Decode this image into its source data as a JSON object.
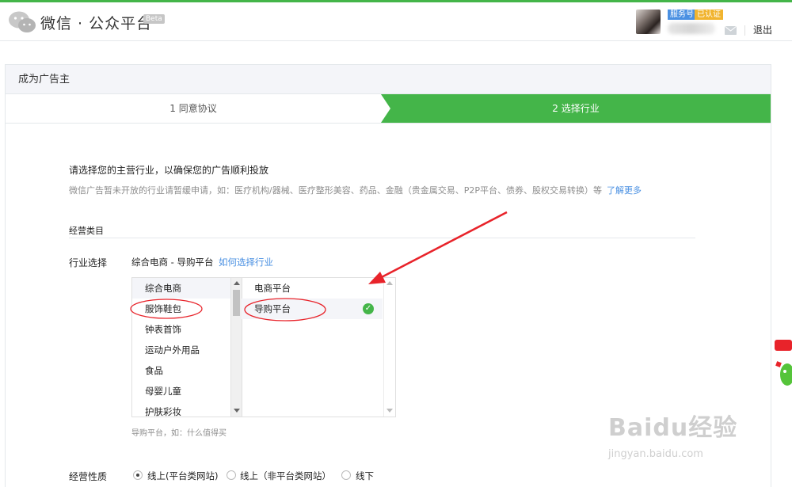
{
  "header": {
    "brand": "微信 · 公众平台",
    "beta": "Beta",
    "badge_service": "服务号",
    "badge_verified": "已认证",
    "logout": "退出"
  },
  "panel": {
    "title": "成为广告主",
    "steps": [
      "1 同意协议",
      "2 选择行业"
    ],
    "active_step": 2
  },
  "intro": {
    "text": "请选择您的主营行业，以确保您的广告顺利投放",
    "note": "微信广告暂未开放的行业请暂缓申请，如：医疗机构/器械、医疗整形美容、药品、金融（贵金属交易、P2P平台、债券、股权交易转换）等",
    "more_link": "了解更多"
  },
  "section": {
    "title": "经营类目"
  },
  "industry": {
    "label": "行业选择",
    "selected": "综合电商 - 导购平台",
    "howto_link": "如何选择行业",
    "categories": [
      "综合电商",
      "服饰鞋包",
      "钟表首饰",
      "运动户外用品",
      "食品",
      "母婴儿童",
      "护肤彩妆"
    ],
    "subcategories": [
      "电商平台",
      "导购平台"
    ],
    "hint": "导购平台，如：什么值得买"
  },
  "nature": {
    "label": "经营性质",
    "options": [
      "线上(平台类网站)",
      "线上（非平台类网站）",
      "线下"
    ],
    "selected_index": 0
  },
  "watermark": {
    "main": "Baidu经验",
    "sub": "jingyan.baidu.com"
  },
  "colors": {
    "accent": "#44b549",
    "link": "#4a90e2",
    "annotation": "#e8232a"
  }
}
